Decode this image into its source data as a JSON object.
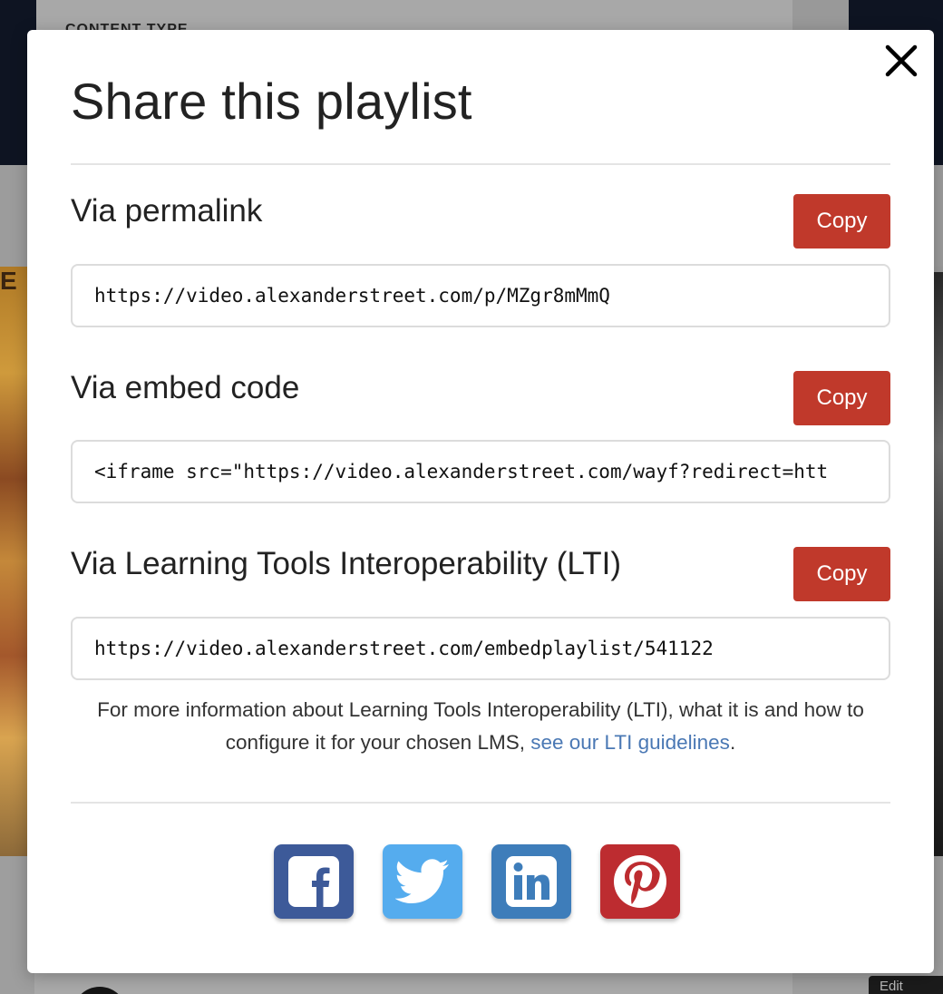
{
  "background": {
    "heading_fragment": "CONTENT TYPE",
    "poster_letter": "E",
    "edit_badge": "Edit"
  },
  "modal": {
    "title": "Share this playlist",
    "close_icon": "close-icon",
    "sections": [
      {
        "title": "Via permalink",
        "copy_label": "Copy",
        "value": "https://video.alexanderstreet.com/p/MZgr8mMmQ"
      },
      {
        "title": "Via embed code",
        "copy_label": "Copy",
        "value": "<iframe src=\"https://video.alexanderstreet.com/wayf?redirect=htt"
      },
      {
        "title": "Via Learning Tools Interoperability (LTI)",
        "copy_label": "Copy",
        "value": "https://video.alexanderstreet.com/embedplaylist/541122"
      }
    ],
    "info_text": "For more information about Learning Tools Interoperability (LTI), what it is and how to configure it for your chosen LMS, ",
    "info_link": "see our LTI guidelines",
    "info_end": ".",
    "social": [
      {
        "name": "facebook",
        "icon": "facebook-icon",
        "color": "#3b5998"
      },
      {
        "name": "twitter",
        "icon": "twitter-icon",
        "color": "#55acee"
      },
      {
        "name": "linkedin",
        "icon": "linkedin-icon",
        "color": "#0e76a8"
      },
      {
        "name": "pinterest",
        "icon": "pinterest-icon",
        "color": "#cb2027"
      }
    ],
    "colors": {
      "copy_button": "#c0392b",
      "link": "#4a78b4"
    }
  }
}
